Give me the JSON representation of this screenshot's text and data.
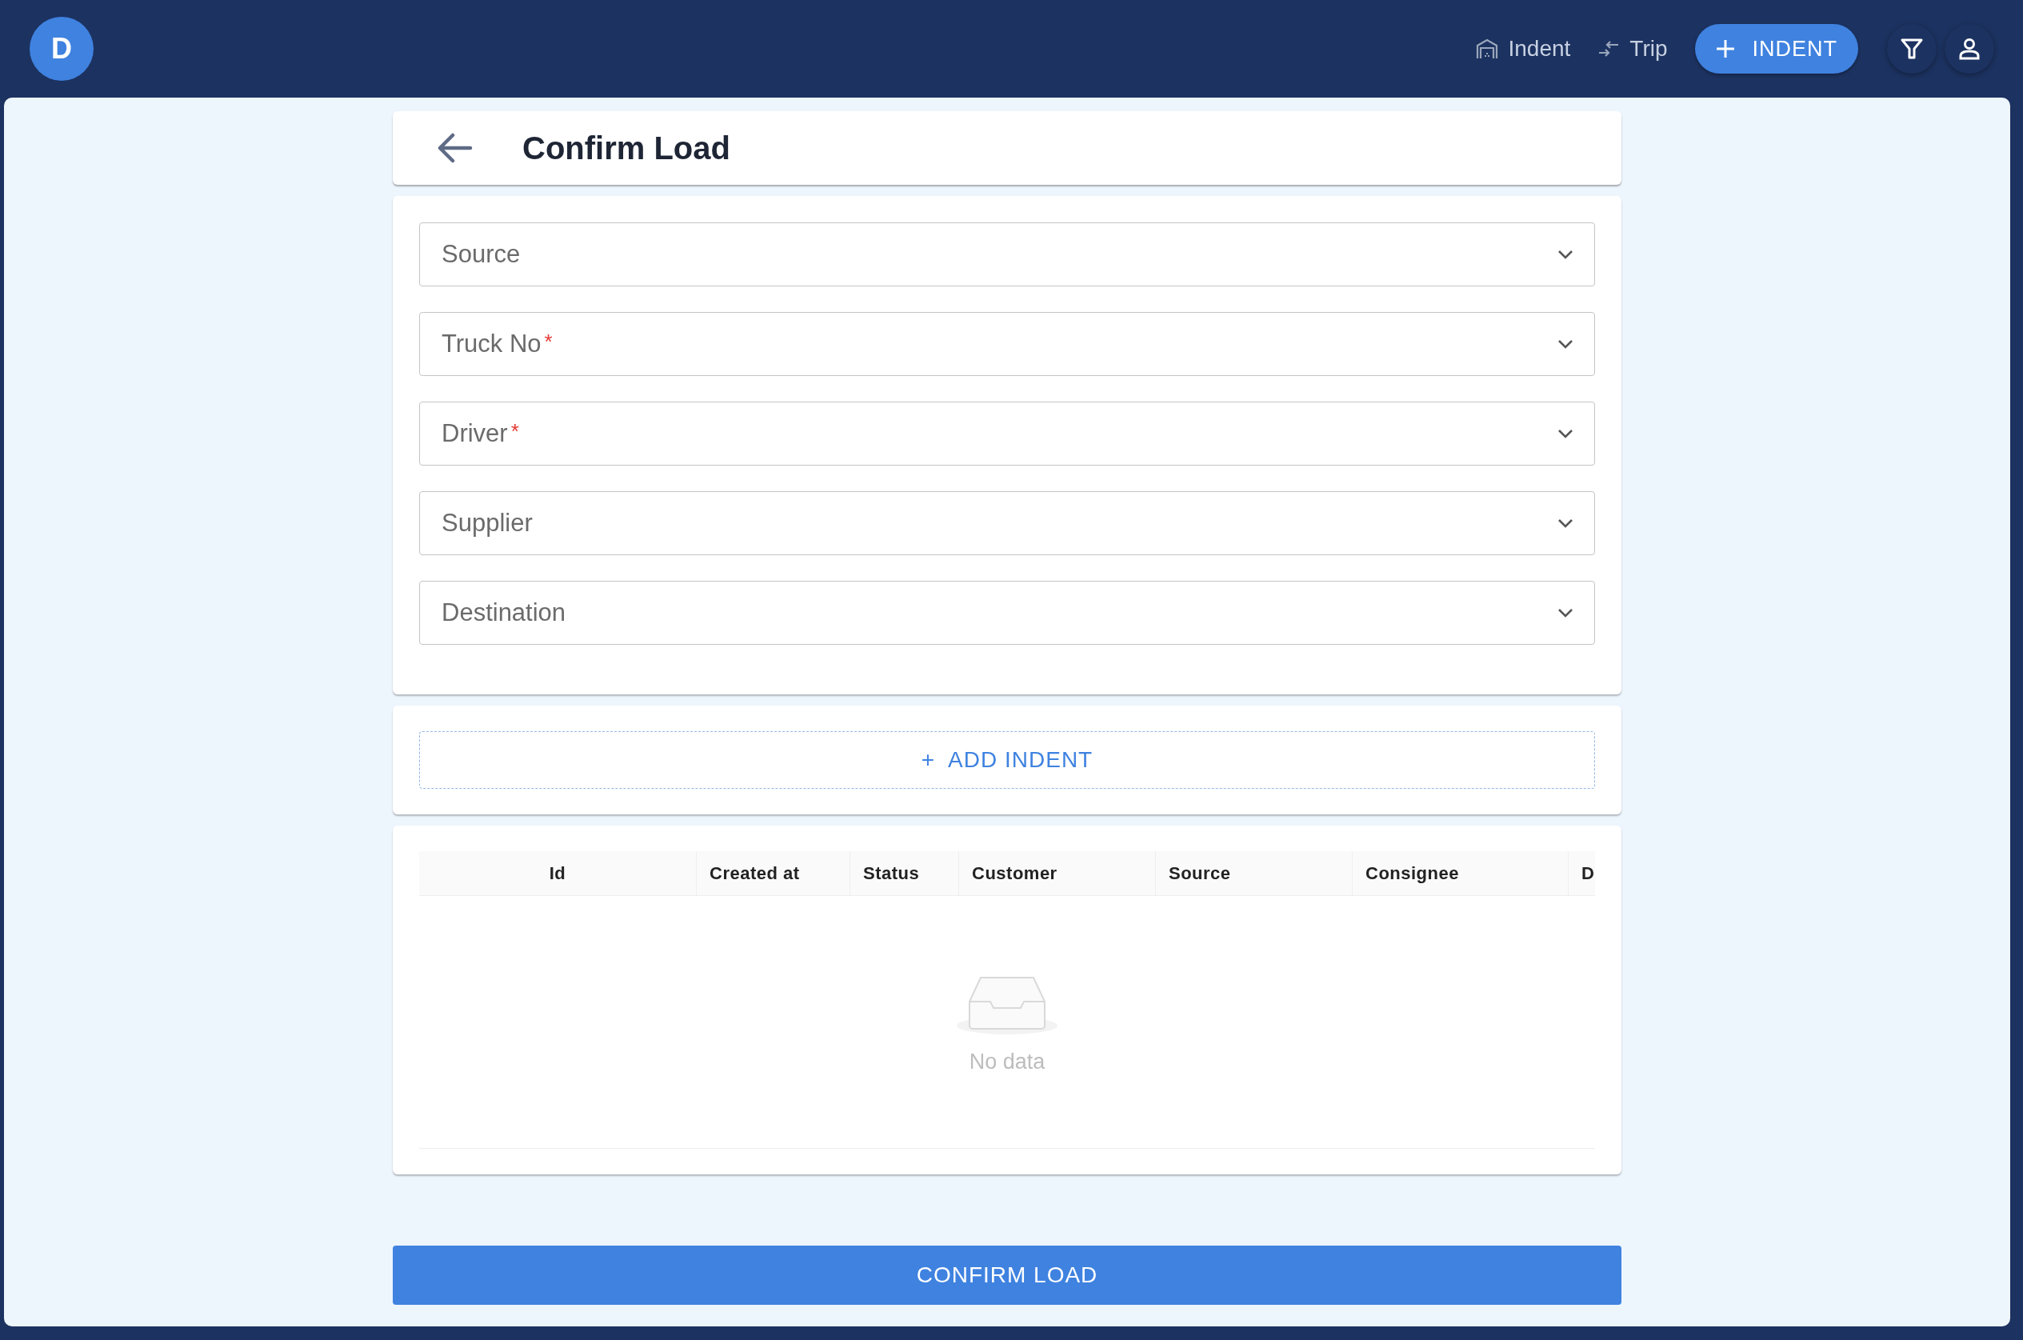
{
  "app_bar": {
    "avatar": "D",
    "nav_links": [
      {
        "kind": "indent",
        "label": "Indent"
      },
      {
        "kind": "trip",
        "label": "Trip"
      }
    ],
    "new_button": "INDENT"
  },
  "page": {
    "title": "Confirm Load"
  },
  "required_marker": "*",
  "fields": [
    {
      "label": "Source",
      "required": false
    },
    {
      "label": "Truck No",
      "required": true
    },
    {
      "label": "Driver",
      "required": true
    },
    {
      "label": "Supplier",
      "required": false
    },
    {
      "label": "Destination",
      "required": false
    }
  ],
  "add_indent": {
    "icon": "+",
    "label": "ADD INDENT"
  },
  "table": {
    "columns": [
      "Id",
      "Created at",
      "Status",
      "Customer",
      "Source",
      "Consignee",
      "D"
    ],
    "empty_text": "No data"
  },
  "confirm_button": "CONFIRM LOAD"
}
